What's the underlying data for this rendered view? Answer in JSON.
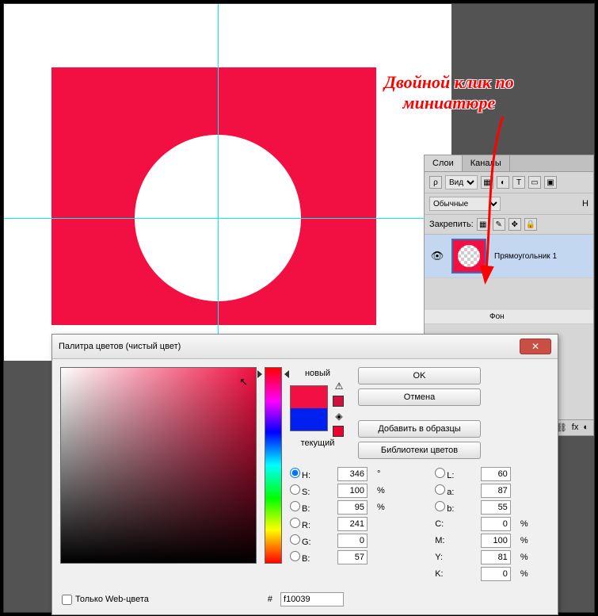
{
  "annotation": {
    "line1": "Двойной клик по",
    "line2": "миниатюре"
  },
  "layers_panel": {
    "tabs": {
      "layers": "Слои",
      "channels": "Каналы"
    },
    "view_label": "Вид",
    "blend_mode": "Обычные",
    "lock_label": "Закрепить:",
    "opacity_abbr": "Н",
    "layer1_name": "Прямоугольник 1",
    "layer2_name": "Фон",
    "footer_fx": "fx"
  },
  "dialog": {
    "title": "Палитра цветов (чистый цвет)",
    "buttons": {
      "ok": "OK",
      "cancel": "Отмена",
      "add_swatch": "Добавить в образцы",
      "color_libs": "Библиотеки цветов"
    },
    "labels": {
      "new": "новый",
      "current": "текущий",
      "web_only": "Только Web-цвета"
    },
    "fields": {
      "H": "346",
      "H_unit": "°",
      "S": "100",
      "S_unit": "%",
      "Bhsv": "95",
      "Bhsv_unit": "%",
      "R": "241",
      "G": "0",
      "Brgb": "57",
      "L": "60",
      "a": "87",
      "b": "55",
      "C": "0",
      "C_unit": "%",
      "M": "100",
      "M_unit": "%",
      "Y": "81",
      "Y_unit": "%",
      "K": "0",
      "K_unit": "%",
      "hex_label": "#",
      "hex": "f10039"
    },
    "field_labels": {
      "H": "H:",
      "S": "S:",
      "Bhsv": "B:",
      "R": "R:",
      "G": "G:",
      "Brgb": "B:",
      "L": "L:",
      "a": "a:",
      "b": "b:",
      "C": "C:",
      "M": "M:",
      "Y": "Y:",
      "K": "K:"
    },
    "colors": {
      "new": "#f11041",
      "current": "#0020f0"
    }
  }
}
